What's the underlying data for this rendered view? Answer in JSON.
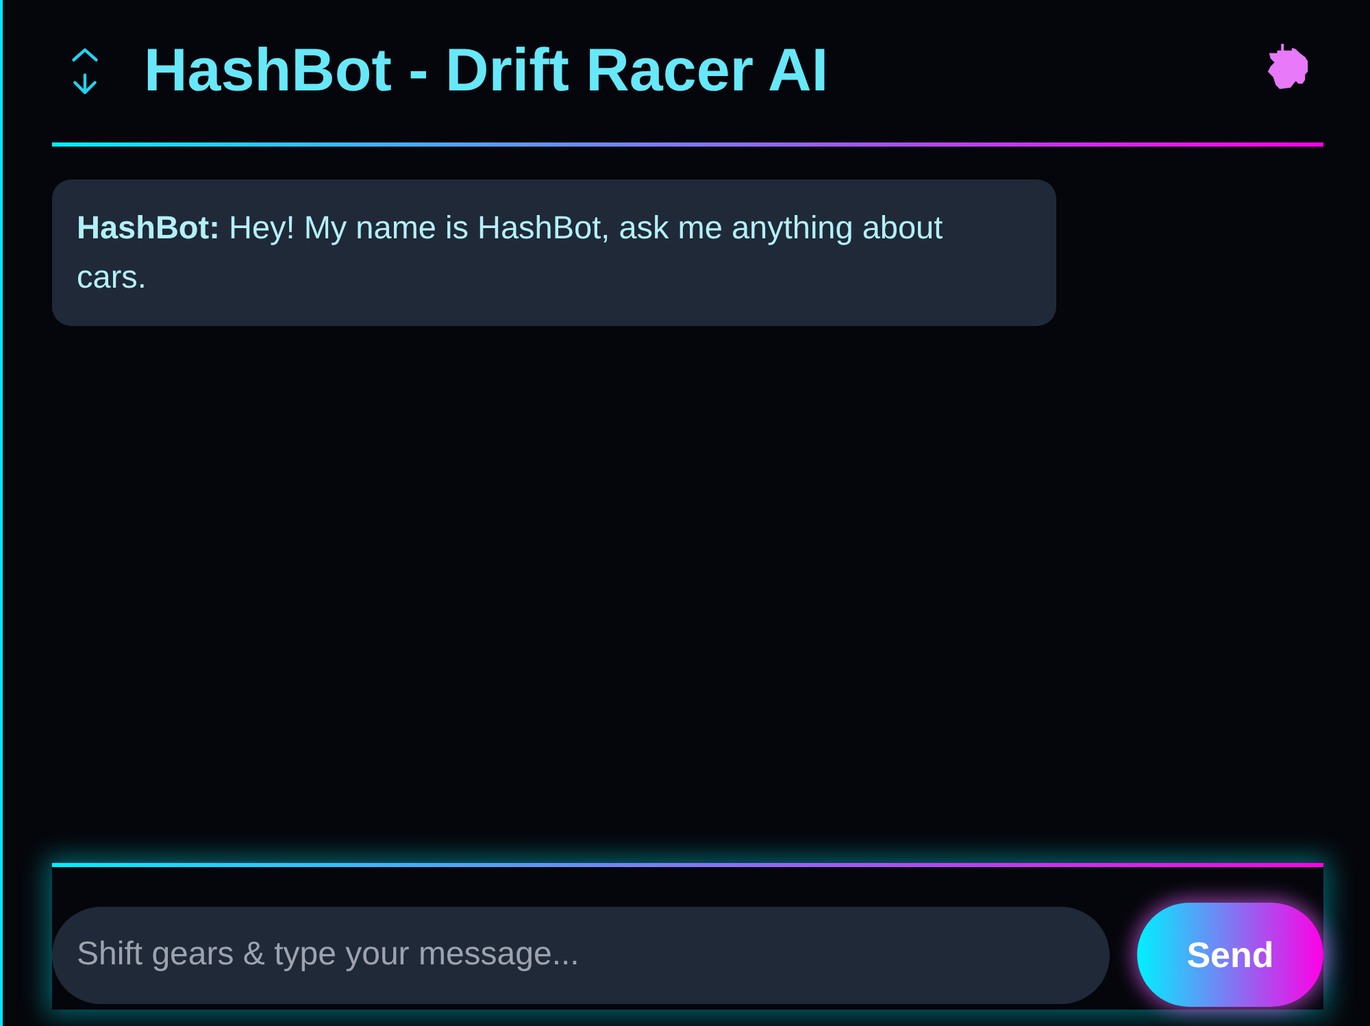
{
  "header": {
    "title": "HashBot - Drift Racer AI"
  },
  "messages": [
    {
      "text": "**HashBot:** Hey! My name is HashBot, ask me anything about cars."
    }
  ],
  "composer": {
    "placeholder": "Shift gears & type your message...",
    "send_label": "Send"
  }
}
